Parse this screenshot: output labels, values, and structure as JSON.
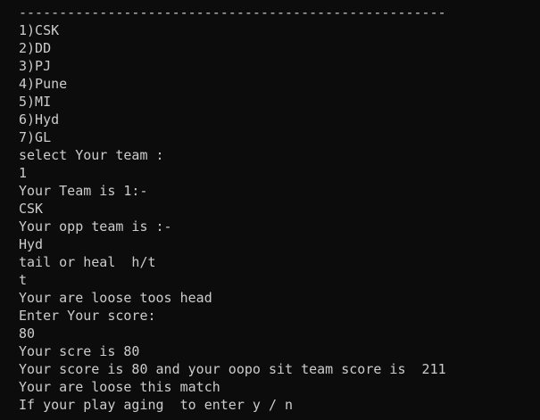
{
  "terminal": {
    "lines": [
      "-----------------------------------------------------",
      "1)CSK",
      "2)DD",
      "3)PJ",
      "4)Pune",
      "5)MI",
      "6)Hyd",
      "7)GL",
      "select Your team :",
      "1",
      "Your Team is 1:-",
      "CSK",
      "Your opp team is :-",
      "Hyd",
      "tail or heal  h/t",
      "t",
      "Your are loose toos head",
      "Enter Your score:",
      "80",
      "Your scre is 80",
      "Your score is 80 and your oopo sit team score is  211",
      "Your are loose this match",
      "If your play aging  to enter y / n"
    ]
  },
  "colors": {
    "background": "#0c0c0c",
    "text": "#cccccc"
  }
}
